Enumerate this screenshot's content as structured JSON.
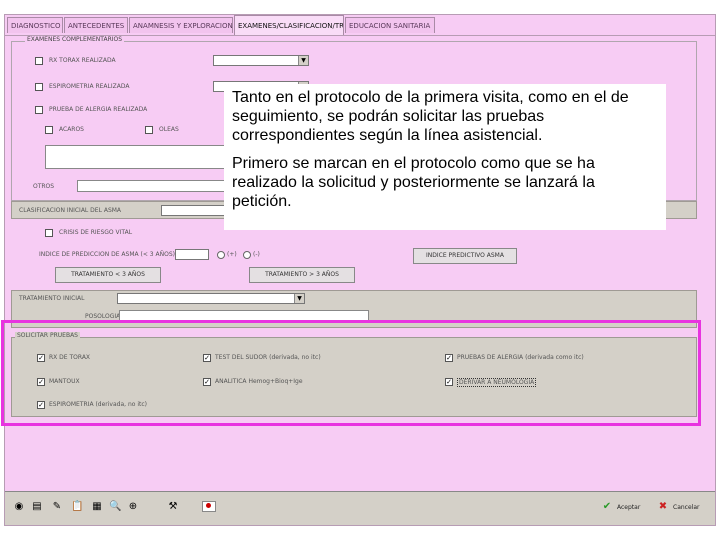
{
  "tabs": [
    "DIAGNOSTICO",
    "ANTECEDENTES",
    "ANAMNESIS Y EXPLORACION",
    "EXAMENES/CLASIFICACION/TR",
    "EDUCACION SANITARIA"
  ],
  "examenes": {
    "title": "EXAMENES COMPLEMENTARIOS",
    "items": [
      "RX TORAX REALIZADA",
      "ESPIROMETRIA REALIZADA",
      "PRUEBA DE ALERGIA REALIZADA"
    ],
    "sub_items": [
      "ACAROS",
      "OLEAS"
    ],
    "otros": "OTROS"
  },
  "clasificacion": {
    "label": "CLASIFICACION INICIAL DEL ASMA",
    "crisis": "CRISIS DE RIESGO VITAL",
    "indice_label": "INDICE DE PREDICCION DE ASMA (< 3 AÑOS)",
    "radio_pos": "(+)",
    "radio_neg": "(-)",
    "indice_btn": "INDICE PREDICTIVO ASMA",
    "trat_lt3": "TRATAMIENTO < 3 AÑOS",
    "trat_gt3": "TRATAMIENTO > 3 AÑOS"
  },
  "tratamiento": {
    "label": "TRATAMIENTO INICIAL",
    "posologia": "POSOLOGIA"
  },
  "solicitar": {
    "title": "SOLICITAR PRUEBAS",
    "items": [
      {
        "label": "RX DE TORAX",
        "checked": true
      },
      {
        "label": "TEST DEL SUDOR (derivada, no itc)",
        "checked": true
      },
      {
        "label": "PRUEBAS DE ALERGIA (derivada como itc)",
        "checked": true
      },
      {
        "label": "MANTOUX",
        "checked": true
      },
      {
        "label": "ANALITICA Hemog+Bioq+Ige",
        "checked": true
      },
      {
        "label": "DERIVAR A NEUMOLOGIA",
        "checked": true
      },
      {
        "label": "ESPIROMETRIA (derivada, no itc)",
        "checked": true
      }
    ]
  },
  "toolbar": {
    "aceptar": "Aceptar",
    "cancelar": "Cancelar"
  },
  "overlay": {
    "p1": "Tanto en el protocolo de la primera visita, como en el de seguimiento, se podrán solicitar las pruebas correspondientes según la línea asistencial.",
    "p2": "Primero se marcan en el protocolo como que se ha realizado la solicitud y posteriormente se lanzará la petición."
  },
  "colors": {
    "window_bg": "#f7ccf4",
    "highlight": "#e833e0",
    "panel_gray": "#d4d0c8"
  }
}
